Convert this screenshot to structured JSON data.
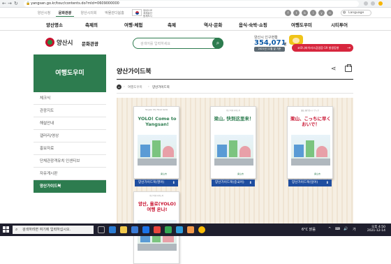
{
  "browser": {
    "url": "yangsan.go.kr/tour/contents.do?mId=0609000000",
    "back": "←",
    "forward": "→",
    "reload": "↻",
    "home": "⌂"
  },
  "utility": {
    "tabs": [
      "양산시청",
      "문화관광",
      "양산시의회",
      "박물관다봄홈"
    ],
    "active_tab": 1,
    "flag_text": [
      "유네스코",
      "세계유산",
      "등재도시"
    ],
    "sns": [
      "f",
      "t",
      "b",
      "i",
      "y",
      "n"
    ],
    "language": "Language"
  },
  "main_nav": [
    "양산명소",
    "축제의",
    "여행·체험",
    "축제",
    "역사·문화",
    "음식·숙박·쇼핑",
    "여행도우미",
    "시티투어"
  ],
  "header": {
    "logo_name": "양산시",
    "logo_sub": "문화관광",
    "search_placeholder": "검색어를 입력하세요",
    "search_icon": "search-icon",
    "pop_label": "양산시 인구현황",
    "pop_number": "354,071",
    "pop_unit": "명",
    "pop_date": "2021년 11월 말 기준",
    "covid_text": "코로나바이러스감염증-19 발생동향",
    "covid_arrow": "→"
  },
  "sidebar": {
    "title": "여행도우미",
    "items": [
      {
        "label": "체크식"
      },
      {
        "label": "관광지도"
      },
      {
        "label": "해설안내"
      },
      {
        "label": "갤러리/영상"
      },
      {
        "label": "홍보자료"
      },
      {
        "label": "단체관광객유치 인센티브"
      },
      {
        "label": "자유게시판"
      },
      {
        "label": "양산가이드북"
      }
    ],
    "active_index": 7
  },
  "content": {
    "title": "양산가이드북",
    "share_icon": "share-icon",
    "print_icon": "print-icon",
    "breadcrumb": [
      "여행도우미",
      "양산가이드북"
    ],
    "books": [
      {
        "band": "Yangsan City Travel Guide",
        "title": "YOLO! Come to Yangsan!",
        "title_color": "#2d7c4f",
        "button": "양산가이드북(영어)"
      },
      {
        "band": "양산 여행 가이드북",
        "title": "梁山, 快到这里来！",
        "title_color": "#2d7c4f",
        "button": "양산가이드북(중국어)"
      },
      {
        "band": "梁山 旅行ガイドブック",
        "title": "梁山、こっちに早くおいで！",
        "title_color": "#c8102e",
        "button": "양산가이드북(일어)"
      },
      {
        "band": "양산 여행 가이드북",
        "title": "양산, 욜로(YOLO) 여행 온나!",
        "title_color": "#c8102e",
        "button": ""
      }
    ],
    "book_footer": "梁山市",
    "download_icon": "⬇"
  },
  "taskbar": {
    "search": "검색하려면 여기에 입력하십시오.",
    "weather": "6°C 맑음",
    "sys": [
      "^",
      "⌨",
      "🔊",
      "가"
    ],
    "time": "오후 4:50",
    "date": "2021-12-14"
  }
}
